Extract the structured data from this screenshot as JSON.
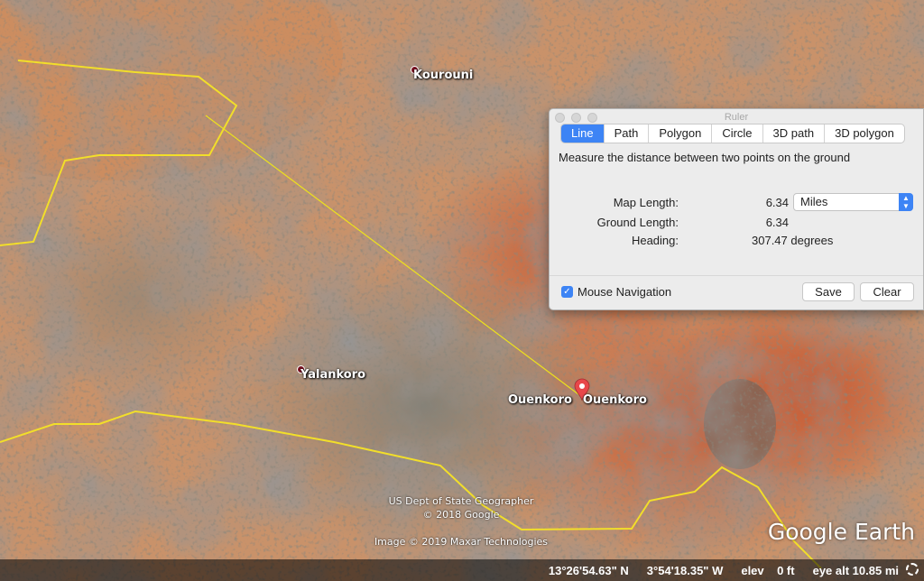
{
  "map": {
    "places": [
      {
        "name": "Kourouni"
      },
      {
        "name": "Yalankoro"
      },
      {
        "name": "Ouenkoro"
      },
      {
        "name": "Ouenkoro"
      }
    ],
    "credits": {
      "line1": "US Dept of State Geographer",
      "line2": "© 2018 Google",
      "line3": "Image © 2019 Maxar Technologies"
    },
    "logo": "Google Earth"
  },
  "ruler": {
    "title": "Ruler",
    "tabs": [
      "Line",
      "Path",
      "Polygon",
      "Circle",
      "3D path",
      "3D polygon"
    ],
    "active_tab": "Line",
    "instruction": "Measure the distance between two points on the ground",
    "map_length_label": "Map Length:",
    "map_length_value": "6.34",
    "unit": "Miles",
    "ground_length_label": "Ground Length:",
    "ground_length_value": "6.34",
    "heading_label": "Heading:",
    "heading_value": "307.47 degrees",
    "mouse_navigation_label": "Mouse Navigation",
    "mouse_navigation_checked": true,
    "save_label": "Save",
    "clear_label": "Clear"
  },
  "status": {
    "lat": "13°26'54.63\" N",
    "lon": "3°54'18.35\" W",
    "elev": "elev    0 ft",
    "eye_alt": "eye alt 10.85 mi"
  },
  "colors": {
    "border_line": "#f2de2a",
    "measure_line": "#ede21c",
    "accent": "#3d84f5",
    "pin": "#e8474a"
  }
}
